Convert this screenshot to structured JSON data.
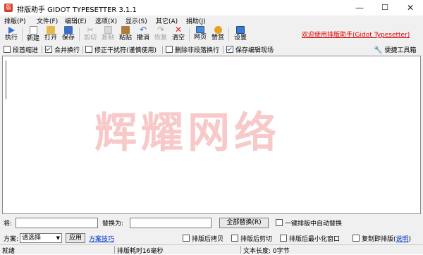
{
  "title_bar": {
    "app_icon": "版",
    "title": "排版助手 GIDOT TYPESETTER 3.1.1",
    "minimize": "—",
    "maximize": "☐",
    "close": "✕"
  },
  "menu": {
    "items": [
      "排版(P)",
      "文件(F)",
      "编辑(E)",
      "选项(X)",
      "显示(S)",
      "其它(A)",
      "捐助(J)"
    ]
  },
  "toolbar": {
    "buttons": [
      {
        "label": "执行",
        "icon": "play-icon",
        "enabled": true
      },
      {
        "label": "新建",
        "icon": "new-file-icon",
        "enabled": true
      },
      {
        "label": "打开",
        "icon": "open-folder-icon",
        "enabled": true
      },
      {
        "label": "保存",
        "icon": "save-icon",
        "enabled": true
      },
      {
        "label": "剪切",
        "icon": "cut-icon",
        "enabled": false
      },
      {
        "label": "复制",
        "icon": "copy-icon",
        "enabled": false
      },
      {
        "label": "粘贴",
        "icon": "paste-icon",
        "enabled": true
      },
      {
        "label": "撤消",
        "icon": "undo-icon",
        "enabled": true
      },
      {
        "label": "恢复",
        "icon": "redo-icon",
        "enabled": false
      },
      {
        "label": "清空",
        "icon": "clear-icon",
        "enabled": true
      },
      {
        "label": "网页",
        "icon": "web-icon",
        "enabled": true
      },
      {
        "label": "赞赏",
        "icon": "donate-icon",
        "enabled": true
      },
      {
        "label": "设置",
        "icon": "settings-icon",
        "enabled": true
      }
    ],
    "welcome": "欢迎使用排版助手(Gidot Typesetter)"
  },
  "options": {
    "items": [
      {
        "label": "段首缩进",
        "checked": false
      },
      {
        "label": "合并换行",
        "checked": true
      },
      {
        "label": "修正干扰符(谨慎使用)",
        "checked": false
      },
      {
        "label": "删除非段落换行",
        "checked": false
      },
      {
        "label": "保存编辑现场",
        "checked": true
      }
    ],
    "toolbox": "便捷工具箱"
  },
  "editor": {
    "content": "",
    "watermark": "辉耀网络"
  },
  "replace": {
    "find_label": "将:",
    "find_value": "",
    "replace_label": "替换为:",
    "replace_value": "",
    "replace_all": "全部替换(R)",
    "auto_label": "一键排版中自动替换",
    "auto_checked": false
  },
  "scheme": {
    "label": "方案:",
    "selected": "请选择",
    "apply": "应用",
    "tips": "方案技巧",
    "options": [
      {
        "label": "排版后拷贝",
        "checked": false
      },
      {
        "label": "排版后剪切",
        "checked": false
      },
      {
        "label": "排版后最小化窗口",
        "checked": false
      },
      {
        "label": "复制即排版",
        "checked": false
      }
    ],
    "help_open": "(",
    "help": "说明",
    "help_close": ")"
  },
  "status": {
    "state": "就绪",
    "time": "排版耗时16毫秒",
    "length": "文本长度: 0字节"
  },
  "colors": {
    "welcome": "#e00000",
    "link": "#0033cc",
    "watermark": "#f7c9c9"
  }
}
